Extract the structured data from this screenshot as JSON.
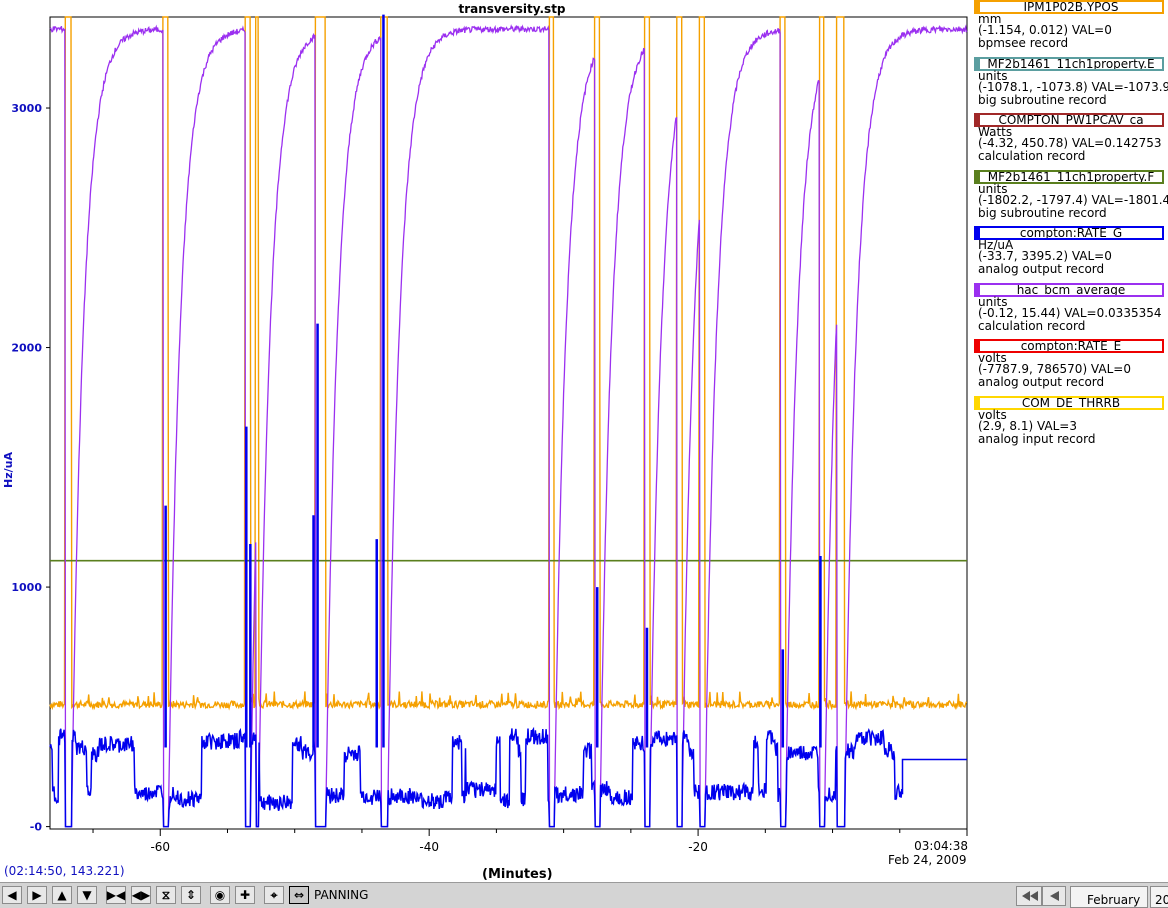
{
  "window": {
    "title": "transversity.stp"
  },
  "chart_data": {
    "type": "line",
    "title": "transversity.stp",
    "xlabel": "(Minutes)",
    "ylabel": "Hz/uA",
    "xlim": [
      -68.2,
      0
    ],
    "ylim": [
      -10,
      3380
    ],
    "x_ticks": [
      -60,
      -40,
      -20
    ],
    "y_ticks": [
      0,
      1000,
      2000,
      3000
    ],
    "grid": true,
    "end_time": "03:04:38",
    "end_date": "Feb 24, 2009",
    "beam_off_intervals": [
      [
        -67.1,
        -66.6
      ],
      [
        -59.8,
        -59.4
      ],
      [
        -53.7,
        -53.3
      ],
      [
        -52.9,
        -52.7
      ],
      [
        -48.5,
        -47.7
      ],
      [
        -43.6,
        -43.1
      ],
      [
        -31.1,
        -30.7
      ],
      [
        -27.7,
        -27.3
      ],
      [
        -24.0,
        -23.6
      ],
      [
        -21.6,
        -21.2
      ],
      [
        -19.9,
        -19.5
      ],
      [
        -13.9,
        -13.5
      ],
      [
        -11.0,
        -10.6
      ],
      [
        -9.7,
        -9.1
      ]
    ],
    "series": [
      {
        "name": "IPM1P02B.YPOS",
        "color": "#f5a000",
        "baseline": 510,
        "high": 3380
      },
      {
        "name": "MF2b1461_11ch1property.E",
        "color": "#5b9ea0"
      },
      {
        "name": "COMPTON_PW1PCAV_ca",
        "color": "#a02828"
      },
      {
        "name": "MF2b1461_11ch1property.F",
        "color": "#5a7f1e",
        "constant": 1110
      },
      {
        "name": "compton:RATE_G",
        "color": "#0000ee",
        "baseline": 330,
        "end_value": 280,
        "spikes": [
          {
            "x": -59.6,
            "y": 1340
          },
          {
            "x": -53.6,
            "y": 1670
          },
          {
            "x": -53.3,
            "y": 1180
          },
          {
            "x": -48.3,
            "y": 2100
          },
          {
            "x": -48.6,
            "y": 1300
          },
          {
            "x": -43.4,
            "y": 3390
          },
          {
            "x": -43.9,
            "y": 1200
          },
          {
            "x": -27.5,
            "y": 1000
          },
          {
            "x": -23.8,
            "y": 830
          },
          {
            "x": -10.9,
            "y": 1130
          },
          {
            "x": -13.7,
            "y": 740
          }
        ]
      },
      {
        "name": "hac_bcm_average",
        "color": "#9b30f0",
        "plateau": 3330
      },
      {
        "name": "compton:RATE_E",
        "color": "#ee0000"
      },
      {
        "name": "COM_DE_THRRB",
        "color": "#ffd700"
      }
    ]
  },
  "legend": [
    {
      "name": "IPM1P02B.YPOS",
      "units": "mm",
      "range": "(-1.154, 0.012) VAL=0",
      "type": "bpmsee record",
      "color": "#f5a000"
    },
    {
      "name": "MF2b1461_11ch1property.E",
      "units": "units",
      "range": "(-1078.1, -1073.8) VAL=-1073.9",
      "type": "big subroutine record",
      "color": "#5b9ea0"
    },
    {
      "name": "COMPTON_PW1PCAV_ca",
      "units": "Watts",
      "range": "(-4.32, 450.78) VAL=0.142753",
      "type": "calculation record",
      "color": "#a02828"
    },
    {
      "name": "MF2b1461_11ch1property.F",
      "units": "units",
      "range": "(-1802.2, -1797.4)  VAL=-1801.4",
      "type": "big subroutine record",
      "color": "#5a7f1e"
    },
    {
      "name": "compton:RATE_G",
      "units": "Hz/uA",
      "range": "(-33.7, 3395.2) VAL=0",
      "type": "analog output record",
      "color": "#0000ee"
    },
    {
      "name": "hac_bcm_average",
      "units": "units",
      "range": "(-0.12, 15.44) VAL=0.0335354",
      "type": "calculation record",
      "color": "#9b30f0"
    },
    {
      "name": "compton:RATE_E",
      "units": "volts",
      "range": "(-7787.9, 786570)  VAL=0",
      "type": "analog output record",
      "color": "#ee0000"
    },
    {
      "name": "COM_DE_THRRB",
      "units": "volts",
      "range": "(2.9, 8.1)  VAL=3",
      "type": "analog input record",
      "color": "#ffd700"
    }
  ],
  "status": {
    "cursor": "(02:14:50, 143.221)",
    "mode": "PANNING"
  },
  "toolbar": {
    "buttons": [
      "pan-left-icon",
      "pan-right-icon",
      "pan-up-icon",
      "pan-down-icon",
      "compress-x-icon",
      "expand-x-icon",
      "compress-y-icon",
      "expand-y-icon",
      "zoom-icon",
      "crosshair-icon",
      "autoscale-icon",
      "pan-mode-icon"
    ]
  },
  "date_selector": {
    "month": "February",
    "year": "20"
  }
}
